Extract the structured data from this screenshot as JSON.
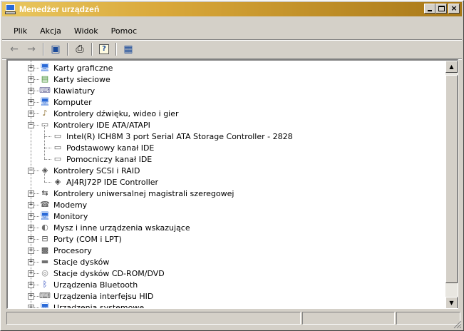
{
  "window": {
    "title": "Menedżer urządzeń",
    "controls": [
      "minimize",
      "maximize",
      "close"
    ],
    "close_glyph": "×"
  },
  "menu": [
    "Plik",
    "Akcja",
    "Widok",
    "Pomoc"
  ],
  "toolbar": {
    "buttons": [
      {
        "name": "back-icon",
        "glyph": "←"
      },
      {
        "name": "forward-icon",
        "glyph": "→"
      },
      {
        "name": "show-hide-tree-icon",
        "glyph": "▣"
      },
      {
        "name": "print-icon",
        "glyph": "⎙"
      },
      {
        "name": "properties-icon",
        "glyph": "?"
      },
      {
        "name": "scan-hardware-icon",
        "glyph": "▦"
      }
    ]
  },
  "tree": {
    "items": [
      {
        "label": "Karty graficzne",
        "level": 1,
        "expand": "+",
        "icon": "🖥"
      },
      {
        "label": "Karty sieciowe",
        "level": 1,
        "expand": "+",
        "icon": "▤"
      },
      {
        "label": "Klawiatury",
        "level": 1,
        "expand": "+",
        "icon": "⌨"
      },
      {
        "label": "Komputer",
        "level": 1,
        "expand": "+",
        "icon": "🖥"
      },
      {
        "label": "Kontrolery dźwięku, wideo i gier",
        "level": 1,
        "expand": "+",
        "icon": "♪"
      },
      {
        "label": "Kontrolery IDE ATA/ATAPI",
        "level": 1,
        "expand": "−",
        "icon": "▭"
      },
      {
        "label": "Intel(R) ICH8M 3 port Serial ATA Storage Controller - 2828",
        "level": 2,
        "expand": "",
        "icon": "▭"
      },
      {
        "label": "Podstawowy kanał IDE",
        "level": 2,
        "expand": "",
        "icon": "▭"
      },
      {
        "label": "Pomocniczy kanał IDE",
        "level": 2,
        "expand": "",
        "icon": "▭"
      },
      {
        "label": "Kontrolery SCSI i RAID",
        "level": 1,
        "expand": "−",
        "icon": "◈"
      },
      {
        "label": "AJ4RJ72P IDE Controller",
        "level": 2,
        "expand": "",
        "icon": "◈"
      },
      {
        "label": "Kontrolery uniwersalnej magistrali szeregowej",
        "level": 1,
        "expand": "+",
        "icon": "⇆"
      },
      {
        "label": "Modemy",
        "level": 1,
        "expand": "+",
        "icon": "☎"
      },
      {
        "label": "Monitory",
        "level": 1,
        "expand": "+",
        "icon": "🖥"
      },
      {
        "label": "Mysz i inne urządzenia wskazujące",
        "level": 1,
        "expand": "+",
        "icon": "◐"
      },
      {
        "label": "Porty (COM i LPT)",
        "level": 1,
        "expand": "+",
        "icon": "⊟"
      },
      {
        "label": "Procesory",
        "level": 1,
        "expand": "+",
        "icon": "▩"
      },
      {
        "label": "Stacje dysków",
        "level": 1,
        "expand": "+",
        "icon": "▬"
      },
      {
        "label": "Stacje dysków CD-ROM/DVD",
        "level": 1,
        "expand": "+",
        "icon": "◎"
      },
      {
        "label": "Urządzenia Bluetooth",
        "level": 1,
        "expand": "+",
        "icon": "ᛒ"
      },
      {
        "label": "Urządzenia interfejsu HID",
        "level": 1,
        "expand": "+",
        "icon": "⌨"
      },
      {
        "label": "Urządzenia systemowe",
        "level": 1,
        "expand": "+",
        "icon": "🖥"
      }
    ]
  },
  "scrollbar": {
    "up_glyph": "▲",
    "down_glyph": "▼"
  },
  "colors": {
    "title_start": "#e9c760",
    "title_end": "#a87818",
    "window_face": "#d4d0c8"
  }
}
